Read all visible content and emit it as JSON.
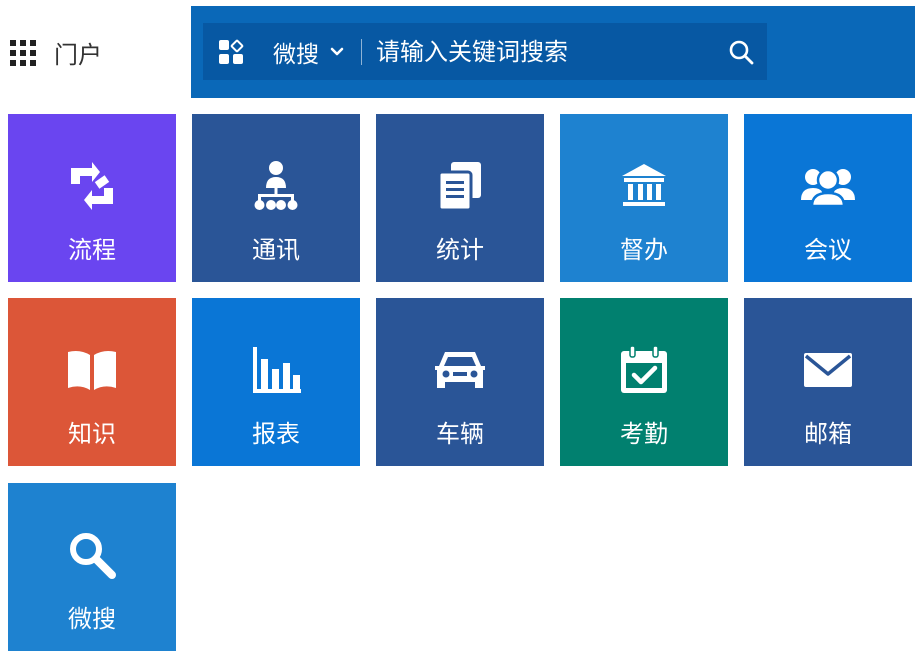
{
  "header": {
    "portal_label": "门户",
    "search": {
      "scope": "微搜",
      "placeholder": "请输入关键词搜索"
    }
  },
  "tiles": [
    {
      "label": "流程",
      "icon": "process-icon",
      "color": "#6a45f0"
    },
    {
      "label": "通讯",
      "icon": "org-chart-icon",
      "color": "#2a5597"
    },
    {
      "label": "统计",
      "icon": "documents-icon",
      "color": "#2a5597"
    },
    {
      "label": "督办",
      "icon": "bank-building-icon",
      "color": "#1e82d0"
    },
    {
      "label": "会议",
      "icon": "people-group-icon",
      "color": "#0a76d6"
    },
    {
      "label": "知识",
      "icon": "open-book-icon",
      "color": "#dc5638"
    },
    {
      "label": "报表",
      "icon": "bar-chart-icon",
      "color": "#0a76d6"
    },
    {
      "label": "车辆",
      "icon": "car-icon",
      "color": "#2a5597"
    },
    {
      "label": "考勤",
      "icon": "calendar-check-icon",
      "color": "#01806f"
    },
    {
      "label": "邮箱",
      "icon": "mail-icon",
      "color": "#2a5597"
    },
    {
      "label": "微搜",
      "icon": "search-icon",
      "color": "#1e82d0"
    }
  ],
  "colors": {
    "header_bg": "#0a68b8",
    "search_bg": "#0758a3"
  }
}
